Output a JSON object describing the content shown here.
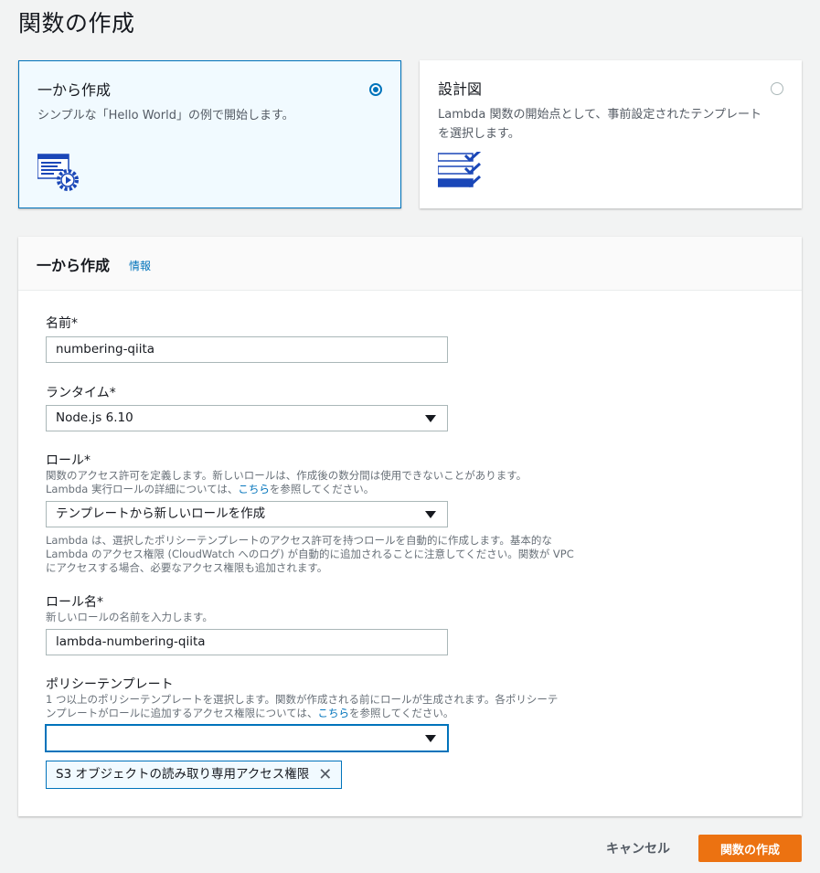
{
  "page": {
    "title": "関数の作成"
  },
  "options": [
    {
      "title": "一から作成",
      "description": "シンプルな「Hello World」の例で開始します。",
      "selected": true,
      "icon": "code-gear-icon"
    },
    {
      "title": "設計図",
      "description_line1": "Lambda 関数の開始点として、事前設定されたテンプレート",
      "description_line2": "を選択します。",
      "selected": false,
      "icon": "checklist-icon"
    }
  ],
  "form": {
    "title": "一から作成",
    "info_link": "情報",
    "name": {
      "label": "名前*",
      "value": "numbering-qiita"
    },
    "runtime": {
      "label": "ランタイム*",
      "value": "Node.js 6.10"
    },
    "role": {
      "label": "ロール*",
      "desc_line1": "関数のアクセス許可を定義します。新しいロールは、作成後の数分間は使用できないことがあります。",
      "desc_line2_pre": "Lambda 実行ロールの詳細については、",
      "desc_link": "こちら",
      "desc_line2_post": "を参照してください。",
      "value": "テンプレートから新しいロールを作成",
      "note_line1": "Lambda は、選択したポリシーテンプレートのアクセス許可を持つロールを自動的に作成します。基本的な",
      "note_line2": "Lambda のアクセス権限 (CloudWatch へのログ) が自動的に追加されることに注意してください。関数が VPC",
      "note_line3": "にアクセスする場合、必要なアクセス権限も追加されます。"
    },
    "role_name": {
      "label": "ロール名*",
      "desc": "新しいロールの名前を入力します。",
      "value": "lambda-numbering-qiita"
    },
    "policy": {
      "label": "ポリシーテンプレート",
      "desc_line1": "1 つ以上のポリシーテンプレートを選択します。関数が作成される前にロールが生成されます。各ポリシーテ",
      "desc_line2_pre": "ンプレートがロールに追加するアクセス権限については、",
      "desc_link": "こちら",
      "desc_line2_post": "を参照してください。",
      "value": "",
      "selected_token": "S3 オブジェクトの読み取り専用アクセス権限"
    }
  },
  "actions": {
    "cancel": "キャンセル",
    "create": "関数の作成"
  },
  "colors": {
    "accent": "#0073bb",
    "primary_button": "#ec7211"
  }
}
